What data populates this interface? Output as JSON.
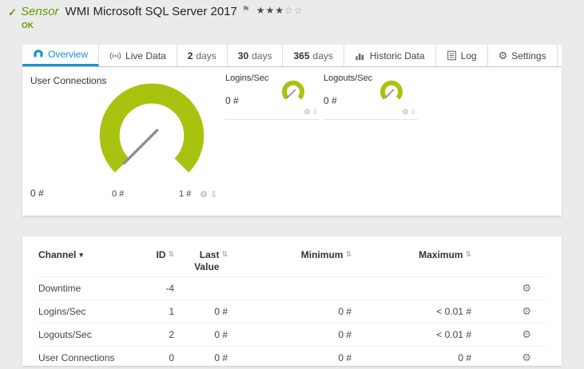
{
  "colors": {
    "gauge_green": "#A9C20F",
    "accent_blue": "#1793D1",
    "ok_green": "#669900",
    "needle_gray": "#8F8F8F",
    "icon_gray": "#666666"
  },
  "header": {
    "kind": "Sensor",
    "title": "WMI Microsoft SQL Server 2017",
    "status": "OK",
    "stars_filled": "★★★",
    "stars_empty": "☆☆"
  },
  "icons": {
    "check": "✓",
    "flag": "⚑",
    "gear": "⚙",
    "download": "⇩",
    "edit": "⚙",
    "sort_desc": "▾",
    "sort_both": "⇅"
  },
  "tabs": {
    "overview": {
      "label": "Overview",
      "icon": "gauge-icon"
    },
    "live_data": {
      "label": "Live Data",
      "icon": "broadcast-icon"
    },
    "d2": {
      "num": "2",
      "unit": "days"
    },
    "d30": {
      "num": "30",
      "unit": "days"
    },
    "d365": {
      "num": "365",
      "unit": "days"
    },
    "historic": {
      "label": "Historic Data",
      "icon": "bar-chart-icon"
    },
    "log": {
      "label": "Log",
      "icon": "document-icon"
    },
    "settings": {
      "label": "Settings",
      "icon": "gear-icon"
    }
  },
  "gauges": {
    "main": {
      "title": "User Connections",
      "value": "0 #",
      "min_label": "0 #",
      "max_label": "1 #"
    },
    "logins": {
      "title": "Logins/Sec",
      "value": "0 #"
    },
    "logouts": {
      "title": "Logouts/Sec",
      "value": "0 #"
    }
  },
  "table": {
    "headers": {
      "channel": "Channel",
      "id": "ID",
      "last_value": "Last Value",
      "minimum": "Minimum",
      "maximum": "Maximum"
    },
    "rows": [
      {
        "channel": "Downtime",
        "id": "-4",
        "last": "",
        "min": "",
        "max": ""
      },
      {
        "channel": "Logins/Sec",
        "id": "1",
        "last": "0 #",
        "min": "0 #",
        "max": "< 0.01 #"
      },
      {
        "channel": "Logouts/Sec",
        "id": "2",
        "last": "0 #",
        "min": "0 #",
        "max": "< 0.01 #"
      },
      {
        "channel": "User Connections",
        "id": "0",
        "last": "0 #",
        "min": "0 #",
        "max": "0 #"
      }
    ]
  }
}
